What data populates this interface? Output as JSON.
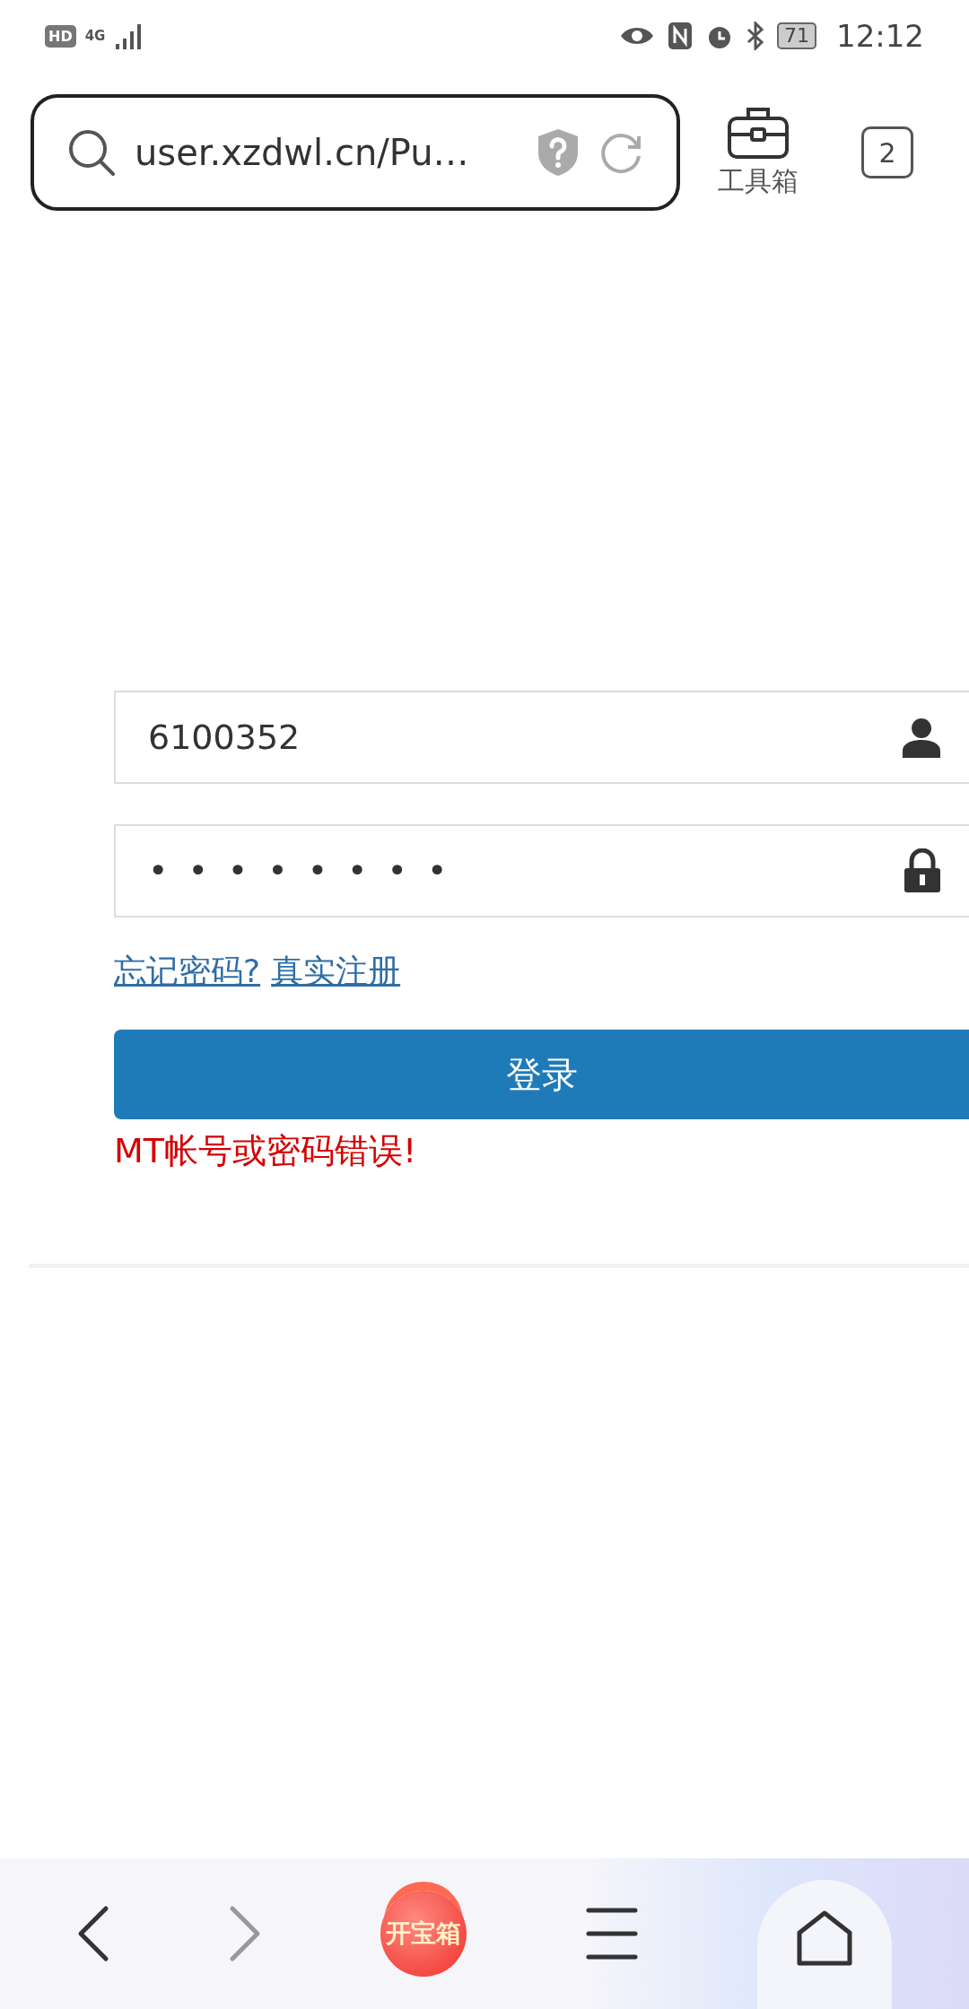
{
  "status_bar": {
    "hd": "HD",
    "network": "4G",
    "battery": "71",
    "time": "12:12"
  },
  "browser_bar": {
    "url": "user.xzdwl.cn/Pu…",
    "toolbox_label": "工具箱",
    "tab_count": "2"
  },
  "login_form": {
    "fields": [
      {
        "kind": "username",
        "value": "6100352"
      },
      {
        "kind": "password",
        "value": "••••••••"
      }
    ],
    "links": [
      "忘记密码?",
      "真实注册"
    ],
    "submit": "登录",
    "error": "MT帐号或密码错误!"
  },
  "bottom_nav": {
    "items": [
      {
        "kind": "back",
        "disabled": false
      },
      {
        "kind": "forward",
        "disabled": true
      },
      {
        "kind": "treasure",
        "label": "开宝箱"
      },
      {
        "kind": "menu"
      },
      {
        "kind": "home",
        "selected": true
      }
    ]
  }
}
